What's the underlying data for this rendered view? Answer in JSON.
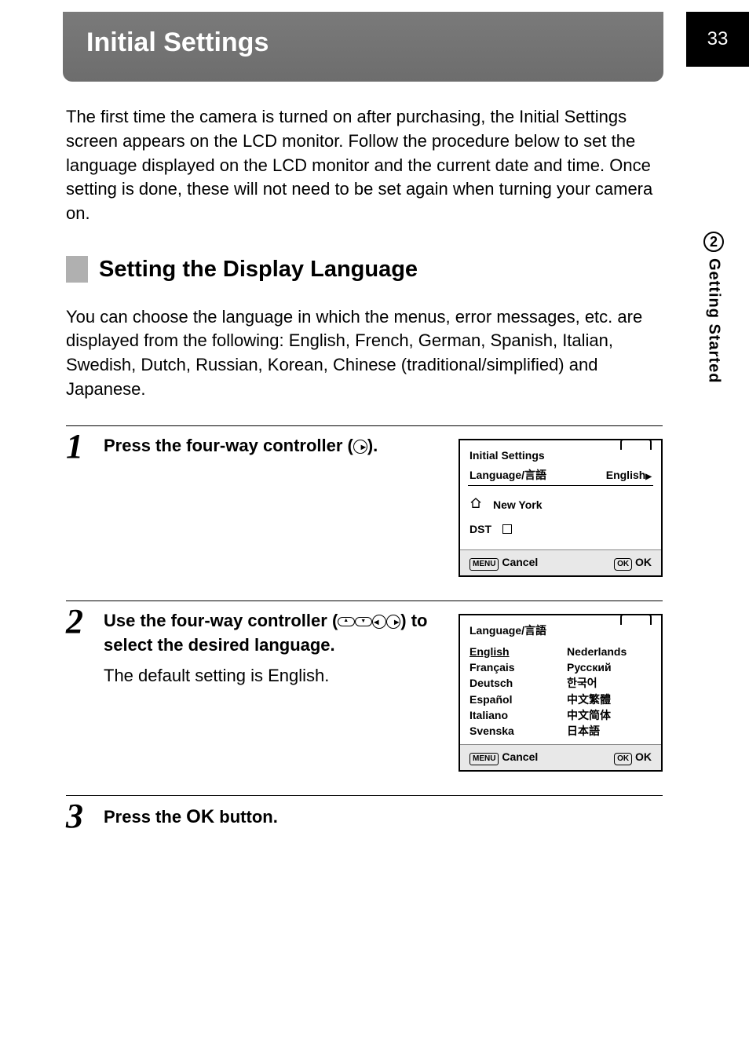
{
  "page_number": "33",
  "side_tab": {
    "number": "2",
    "label": "Getting Started"
  },
  "header_title": "Initial Settings",
  "intro": "The first time the camera is turned on after purchasing, the Initial Settings screen appears on the LCD monitor. Follow the procedure below to set the language displayed on the LCD monitor and the current date and time. Once setting is done, these will not need to be set again when turning your camera on.",
  "section_heading": "Setting the Display Language",
  "section_para": "You can choose the language in which the menus, error messages, etc. are displayed from the following: English, French, German, Spanish, Italian, Swedish, Dutch, Russian, Korean, Chinese (traditional/simplified) and Japanese.",
  "steps": [
    {
      "num": "1",
      "title_pre": "Press the four-way controller (",
      "title_post": ")."
    },
    {
      "num": "2",
      "title_pre": "Use the four-way controller (",
      "title_post": ") to select the desired language.",
      "sub": "The default setting is English."
    },
    {
      "num": "3",
      "title_pre": "Press the ",
      "title_ok": "OK",
      "title_post": " button."
    }
  ],
  "lcd1": {
    "title": "Initial Settings",
    "row_label": "Language/言語",
    "row_value": "English",
    "city": "New York",
    "dst_label": "DST",
    "menu_badge": "MENU",
    "cancel": "Cancel",
    "ok_badge": "OK",
    "ok": "OK"
  },
  "lcd2": {
    "title": "Language/言語",
    "col1": [
      "English",
      "Français",
      "Deutsch",
      "Español",
      "Italiano",
      "Svenska"
    ],
    "col2": [
      "Nederlands",
      "Русский",
      "한국어",
      "中文繁體",
      "中文简体",
      "日本語"
    ],
    "menu_badge": "MENU",
    "cancel": "Cancel",
    "ok_badge": "OK",
    "ok": "OK"
  }
}
